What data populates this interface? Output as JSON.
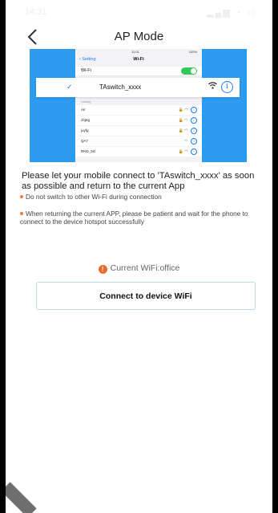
{
  "status_bar": {
    "time": "14:31",
    "right_icons": "signal wifi battery"
  },
  "nav": {
    "title": "AP Mode"
  },
  "illustration": {
    "mini_time": "11:01",
    "mini_battery": "100%",
    "back_label": "Setting",
    "header_title": "Wi-Fi",
    "wifi_row_label": "Wi-Fi",
    "wifi_toggle_on": true,
    "connected_network": "TAswitch_xxxx",
    "loading_label": "Loading",
    "networks": [
      {
        "name": "Air",
        "locked": true
      },
      {
        "name": "cfq5g",
        "locked": true
      },
      {
        "name": "juyfg",
        "locked": true
      },
      {
        "name": "QA7",
        "locked": false
      },
      {
        "name": "RND_5G",
        "locked": true
      }
    ],
    "accent_color": "#2d9cf0"
  },
  "instructions": {
    "main": "Please let your mobile connect to 'TAswitch_xxxx' as soon as possible and return to the current App",
    "note1": "Do not switch to other Wi-Fi during connection",
    "note2": "When returning the current APP, please be patient and wait for the phone to connect to the device hotspot successfully"
  },
  "current_wifi": {
    "badge": "!",
    "label": "Current WiFi:office"
  },
  "connect_button": {
    "label": "Connect to device WiFi"
  }
}
